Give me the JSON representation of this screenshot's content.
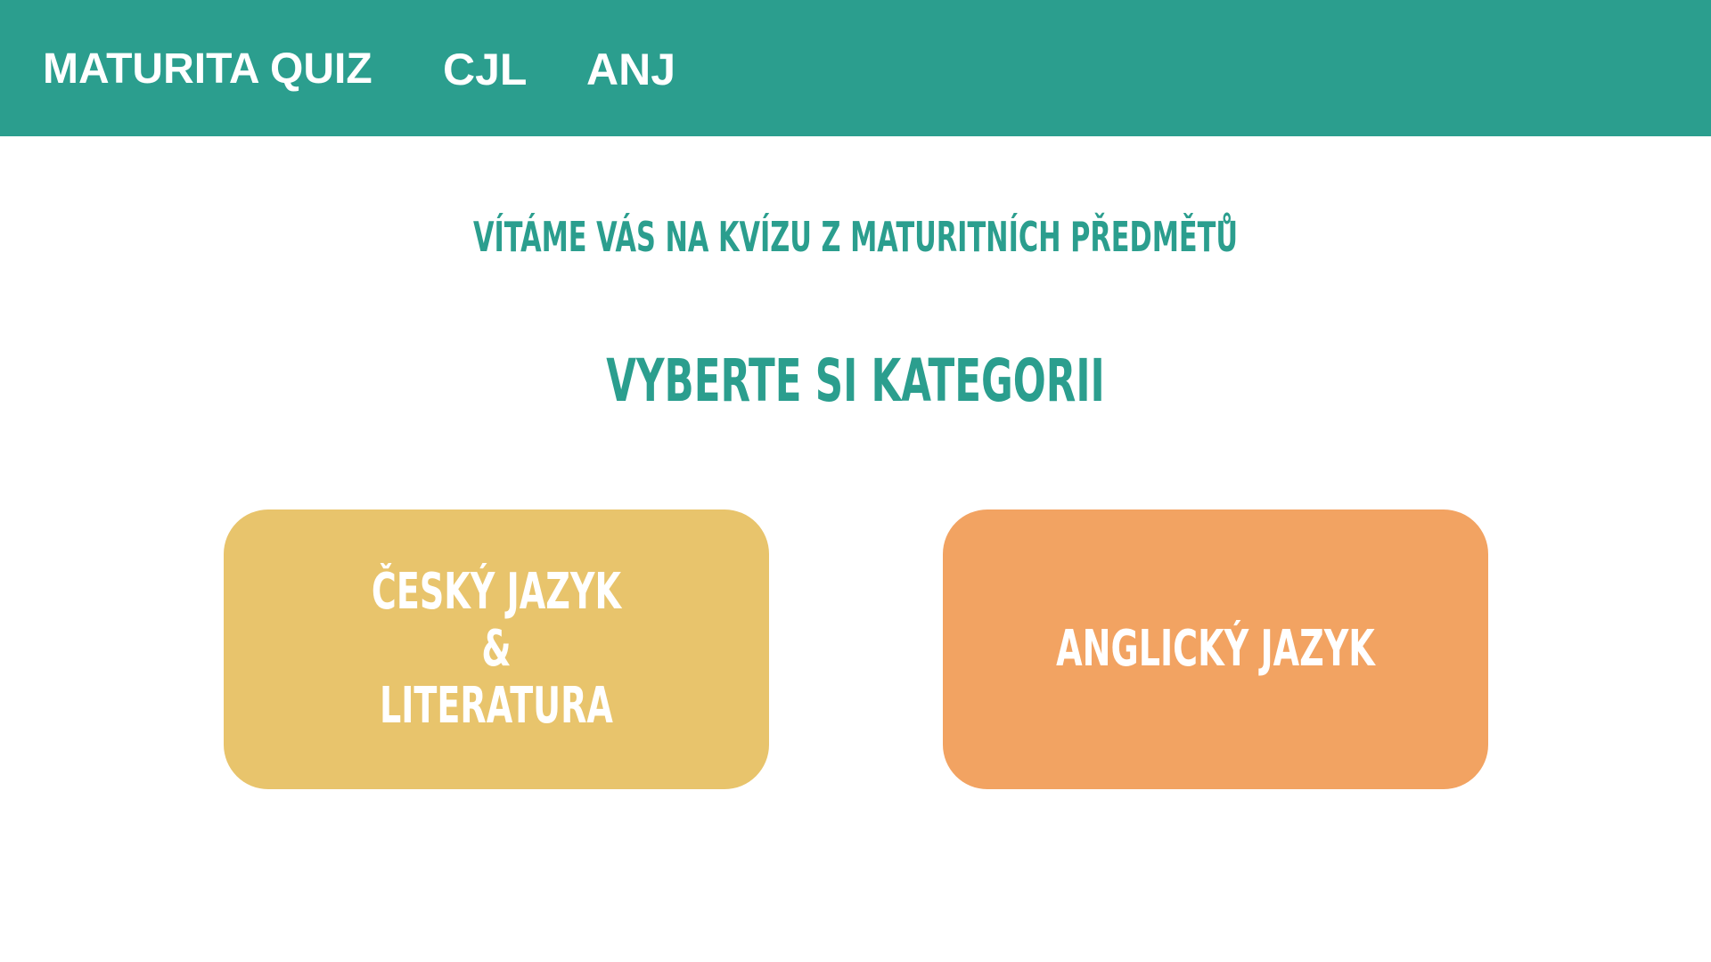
{
  "header": {
    "logo": "MATURITA QUIZ",
    "nav": [
      {
        "label": "CJL"
      },
      {
        "label": "ANJ"
      }
    ],
    "background_color": "#2b9e8e"
  },
  "main": {
    "welcome": "VÍTÁME VÁS NA KVÍZU Z MATURITNÍCH PŘEDMĚTŮ",
    "select_title": "VYBERTE SI KATEGORII",
    "categories": [
      {
        "line1": "ČESKÝ JAZYK",
        "line2": "&",
        "line3": "LITERATURA",
        "color": "#e8c46c"
      },
      {
        "label": "ANGLICKÝ JAZYK",
        "color": "#f2a362"
      }
    ],
    "accent_color": "#2b9e8e"
  }
}
